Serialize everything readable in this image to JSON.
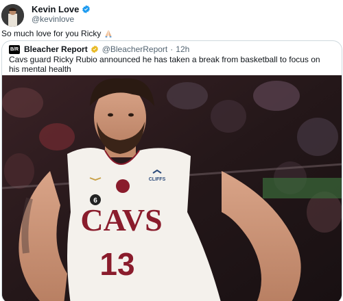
{
  "author": {
    "display_name": "Kevin Love",
    "handle": "@kevinlove"
  },
  "tweet": {
    "text": "So much love for you Ricky"
  },
  "quoted": {
    "logo_text": "B/R",
    "display_name": "Bleacher Report",
    "handle": "@BleacherReport",
    "separator": "·",
    "time": "12h",
    "text": "Cavs guard Ricky Rubio announced he has taken a break from basketball to focus on his mental health"
  },
  "photo": {
    "jersey_team": "CAVS",
    "jersey_number": "13",
    "patch_number": "6",
    "sponsor": "CLIFFS"
  },
  "colors": {
    "verified": "#1d9bf0",
    "handle_gray": "#536471",
    "border": "#cfd9de",
    "jersey_red": "#8a1c2c",
    "gold_badge": "#e8b923"
  }
}
